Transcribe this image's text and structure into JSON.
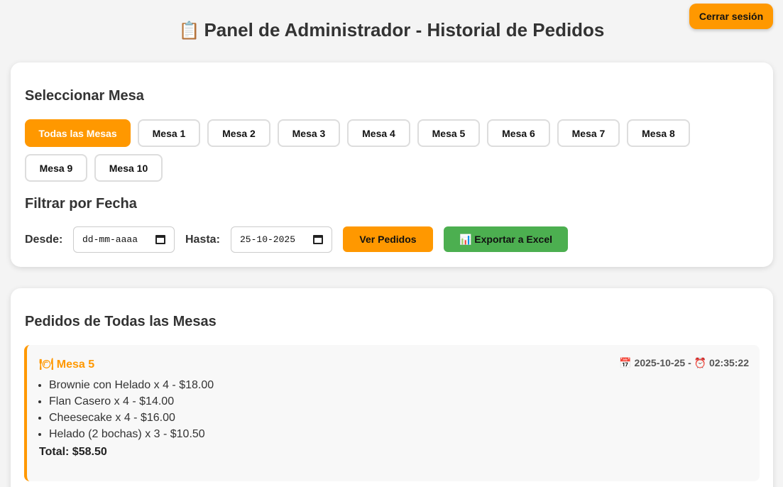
{
  "header": {
    "title_icon": "📋",
    "title": "Panel de Administrador - Historial de Pedidos",
    "logout_label": "Cerrar sesión"
  },
  "filters": {
    "mesa_heading": "Seleccionar Mesa",
    "mesa_buttons": [
      "Todas las Mesas",
      "Mesa 1",
      "Mesa 2",
      "Mesa 3",
      "Mesa 4",
      "Mesa 5",
      "Mesa 6",
      "Mesa 7",
      "Mesa 8",
      "Mesa 9",
      "Mesa 10"
    ],
    "active_mesa": "Todas las Mesas",
    "date_heading": "Filtrar por Fecha",
    "desde_label": "Desde:",
    "desde_value": "dd-mm-aaaa",
    "hasta_label": "Hasta:",
    "hasta_value": "25-10-2025",
    "ver_label": "Ver Pedidos",
    "export_icon": "📊",
    "export_label": "Exportar a Excel"
  },
  "orders": {
    "heading": "Pedidos de Todas las Mesas",
    "list": [
      {
        "mesa_icon": "🍽",
        "mesa": "Mesa 5",
        "date_icon": "📅",
        "date": "2025-10-25",
        "separator": "-",
        "time_icon": "⏰",
        "time": "02:35:22",
        "items": [
          "Brownie con Helado x 4 - $18.00",
          "Flan Casero x 4 - $14.00",
          "Cheesecake x 4 - $16.00",
          "Helado (2 bochas) x 3 - $10.50"
        ],
        "total": "Total: $58.50"
      }
    ]
  },
  "colors": {
    "accent": "#ff9800",
    "export_green": "#4caf50",
    "background": "#f4f4f4"
  }
}
